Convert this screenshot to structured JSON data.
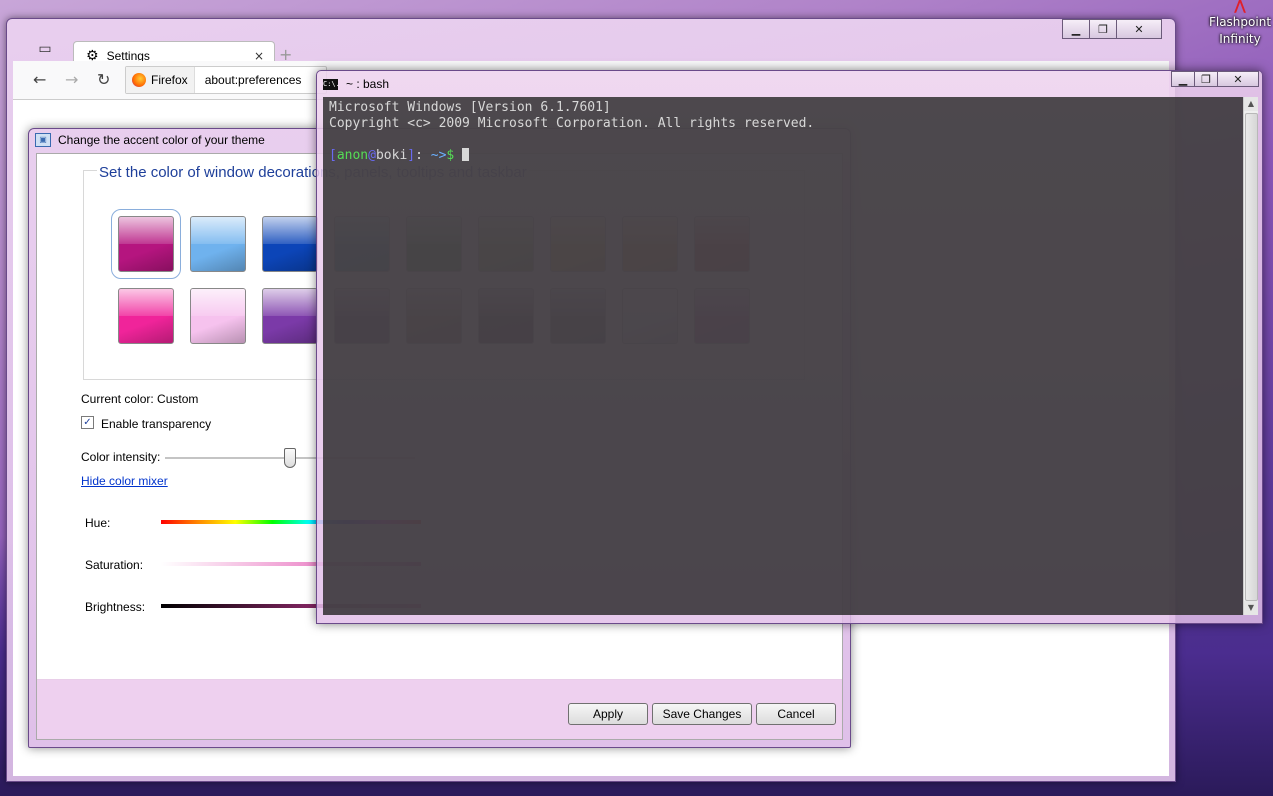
{
  "desktop": {
    "icon_label_line1": "Flashpoint",
    "icon_label_line2": "Infinity"
  },
  "firefox": {
    "tab_title": "Settings",
    "tab_close": "×",
    "new_tab": "+",
    "identity_label": "Firefox",
    "url": "about:preferences",
    "caption": {
      "minimize": "▁",
      "maximize": "❐",
      "close": "✕"
    }
  },
  "accent_dialog": {
    "title": "Change the accent color of your theme",
    "group_title": "Set the color of window decorations, panels, tooltips and taskbar",
    "swatches_row1": [
      "#b5157f",
      "#6fb2ee",
      "#0c45b8",
      "#129aa8",
      "#2d9a22",
      "#8ab830",
      "#e2b81a",
      "#e4951a",
      "#c01818"
    ],
    "swatches_row2": [
      "#f0249a",
      "#f6c2ee",
      "#7b3aa8",
      "#5a2a6a",
      "#8a6a3a",
      "#3a1a12",
      "#4a4a4a",
      "#f4f4f4",
      "#b52a9a"
    ],
    "current_color": "Current color: Custom",
    "enable_transparency": "Enable transparency",
    "transparency_checked": true,
    "color_intensity_label": "Color intensity:",
    "color_intensity_value": 0.5,
    "hide_color_mixer": "Hide color mixer",
    "hue_label": "Hue:",
    "saturation_label": "Saturation:",
    "brightness_label": "Brightness:",
    "buttons": {
      "apply": "Apply",
      "save": "Save Changes",
      "cancel": "Cancel"
    }
  },
  "terminal": {
    "title": "~ : bash",
    "icon_text": "C:\\.",
    "line1": "Microsoft Windows [Version 6.1.7601]",
    "line2": "Copyright <c> 2009 Microsoft Corporation. All rights reserved.",
    "prompt_open": "[",
    "prompt_user": "anon",
    "prompt_at": "@",
    "prompt_host": "boki",
    "prompt_close": "]",
    "prompt_sep": ": ",
    "prompt_path": "~",
    "prompt_arrow": ">",
    "prompt_dollar": "$ "
  }
}
